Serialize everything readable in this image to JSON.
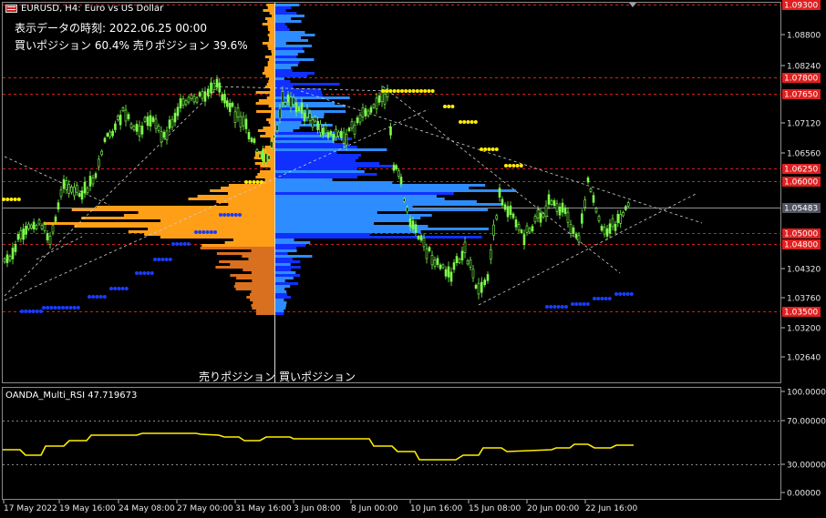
{
  "header": {
    "symbol_label": "EURUSD, H4:",
    "description": "Euro vs US Dollar",
    "flag_icon": "eu-us-flag-icon"
  },
  "info": {
    "timestamp_label": "表示データの時刻: 2022.06.25 00:00",
    "positions_label": "買いポジション 60.4% 売りポジション 39.6%"
  },
  "axis_names": {
    "sell": "売りポジション",
    "buy": "買いポジション"
  },
  "price_axis": {
    "ticks": [
      "1.08800",
      "1.08240",
      "1.07120",
      "1.06560",
      "1.04320",
      "1.03760",
      "1.03200",
      "1.02640"
    ],
    "badges": [
      {
        "text": "1.09300",
        "color": "#e02020"
      },
      {
        "text": "1.07800",
        "color": "#e02020"
      },
      {
        "text": "1.07650",
        "color": "#e02020"
      },
      {
        "text": "1.06250",
        "color": "#e02020"
      },
      {
        "text": "1.06000",
        "color": "#e02020"
      },
      {
        "text": "1.05483",
        "color": "#505560"
      },
      {
        "text": "1.05000",
        "color": "#e02020"
      },
      {
        "text": "1.04800",
        "color": "#e02020"
      },
      {
        "text": "1.03500",
        "color": "#e02020"
      }
    ]
  },
  "time_axis": {
    "labels": [
      "17 May 2022",
      "19 May 16:00",
      "24 May 08:00",
      "27 May 00:00",
      "31 May 16:00",
      "3 Jun 08:00",
      "8 Jun 00:00",
      "10 Jun 16:00",
      "15 Jun 08:00",
      "20 Jun 00:00",
      "22 Jun 16:00"
    ]
  },
  "rsi": {
    "name": "OANDA_Multi_RSI 47.719673",
    "ticks": [
      "100.00000",
      "70.00000",
      "30.00000",
      "0.00000"
    ],
    "line_color": "#ffee00"
  },
  "colors": {
    "candle": "#7cff4a",
    "sell": "#ff9f18",
    "sell_dark": "#d97020",
    "buy": "#1030ff",
    "buy_light": "#2d8cff",
    "level": "#d02020",
    "yellow_dots": "#ffee00",
    "blue_dots": "#1a3cff"
  }
}
